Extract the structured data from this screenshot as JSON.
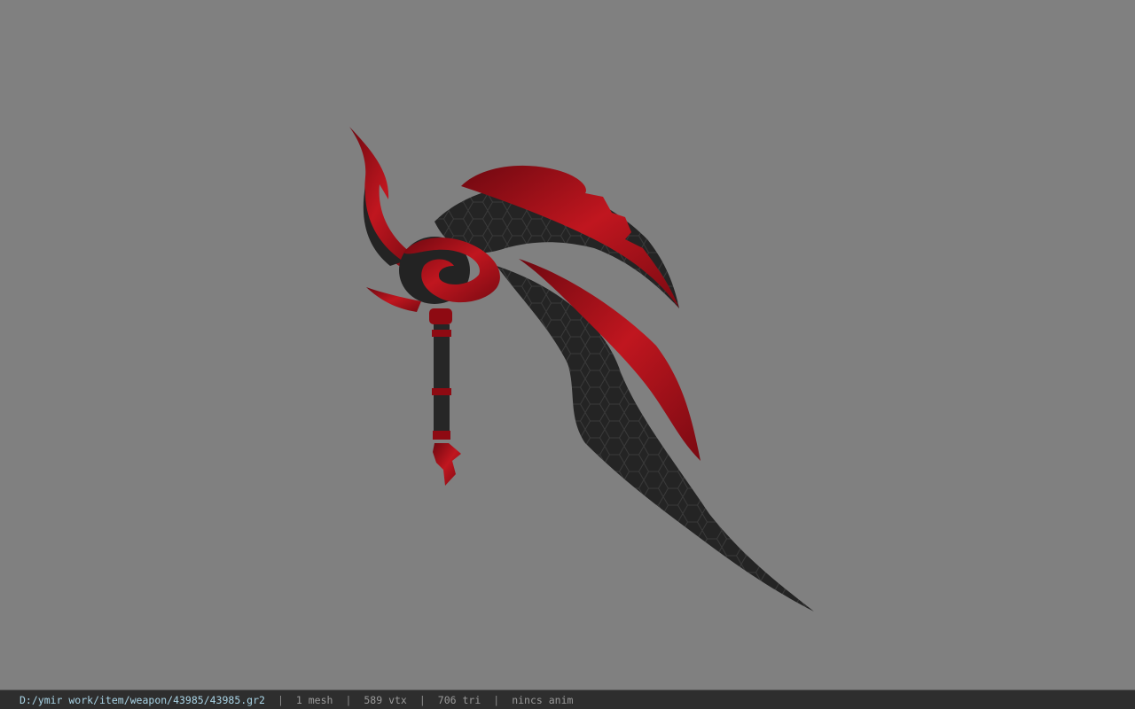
{
  "viewer": {
    "background_color": "#808080",
    "model_colors": {
      "blade_dark": "#232323",
      "blade_red": "#8e0a12",
      "blade_red_highlight": "#c0161f"
    }
  },
  "statusbar": {
    "file_path": "D:/ymir work/item/weapon/43985/43985.gr2",
    "separator": "|",
    "mesh_count": "1 mesh",
    "vertex_count": "589 vtx",
    "triangle_count": "706 tri",
    "anim_status": "nincs anim"
  }
}
